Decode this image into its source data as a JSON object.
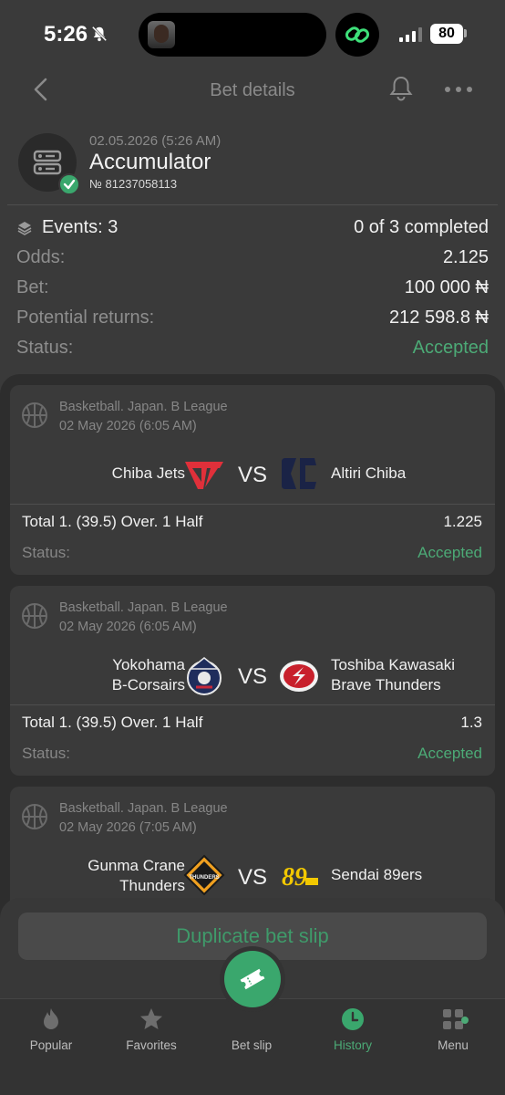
{
  "status_bar": {
    "time": "5:26",
    "battery": "80"
  },
  "nav": {
    "title": "Bet details"
  },
  "bet": {
    "date": "02.05.2026 (5:26 AM)",
    "type": "Accumulator",
    "number": "№ 81237058113"
  },
  "summary": {
    "events_label": "Events: 3",
    "completed": "0 of 3 completed",
    "odds_label": "Odds:",
    "odds_value": "2.125",
    "bet_label": "Bet:",
    "bet_value": "100 000 ₦",
    "returns_label": "Potential returns:",
    "returns_value": "212 598.8 ₦",
    "status_label": "Status:",
    "status_value": "Accepted"
  },
  "events": [
    {
      "league": "Basketball. Japan. B League",
      "date": "02 May 2026 (6:05 AM)",
      "team1": "Chiba Jets",
      "team2": "Altiri Chiba",
      "vs": "VS",
      "market": "Total 1. (39.5) Over. 1 Half",
      "odds": "1.225",
      "status_label": "Status:",
      "status": "Accepted"
    },
    {
      "league": "Basketball. Japan. B League",
      "date": "02 May 2026 (6:05 AM)",
      "team1_line1": "Yokohama",
      "team1_line2": "B-Corsairs",
      "team2_line1": "Toshiba Kawasaki",
      "team2_line2": "Brave Thunders",
      "vs": "VS",
      "market": "Total 1. (39.5) Over. 1 Half",
      "odds": "1.3",
      "status_label": "Status:",
      "status": "Accepted"
    },
    {
      "league": "Basketball. Japan. B League",
      "date": "02 May 2026 (7:05 AM)",
      "team1_line1": "Gunma Crane",
      "team1_line2": "Thunders",
      "team2": "Sendai 89ers",
      "vs": "VS",
      "logo1_text": "THUNDERS",
      "logo2_text": "89"
    }
  ],
  "duplicate_label": "Duplicate bet slip",
  "tabs": [
    {
      "label": "Popular",
      "icon": "flame-icon"
    },
    {
      "label": "Favorites",
      "icon": "star-icon"
    },
    {
      "label": "Bet slip",
      "icon": "ticket-icon"
    },
    {
      "label": "History",
      "icon": "clock-icon",
      "active": true
    },
    {
      "label": "Menu",
      "icon": "grid-icon"
    }
  ],
  "colors": {
    "accent": "#4caa76",
    "background": "#3a3a3a",
    "panel": "#2d2d2d"
  }
}
